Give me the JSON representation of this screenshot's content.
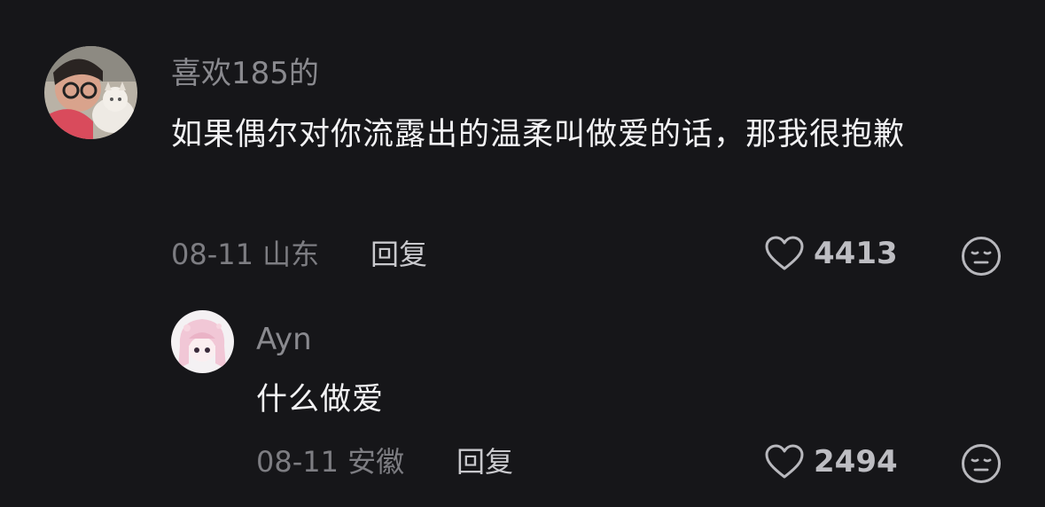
{
  "comments": [
    {
      "username": "喜欢185的",
      "text": "如果偶尔对你流露出的温柔叫做爱的话，那我很抱歉",
      "date": "08-11 山东",
      "reply_label": "回复",
      "likes": "4413",
      "avatar_icon": "user-photo-with-cat",
      "like_icon": "heart-outline",
      "reaction_icon": "neutral-face"
    },
    {
      "username": "Ayn",
      "text": "什么做爱",
      "date": "08-11 安徽",
      "reply_label": "回复",
      "likes": "2494",
      "avatar_icon": "anime-girl-avatar",
      "like_icon": "heart-outline",
      "reaction_icon": "neutral-face"
    }
  ],
  "colors": {
    "background": "#161619",
    "username": "#8a8a8f",
    "text": "#f2f2f4",
    "meta": "#7d7d82",
    "icon": "#b8b8bd"
  }
}
